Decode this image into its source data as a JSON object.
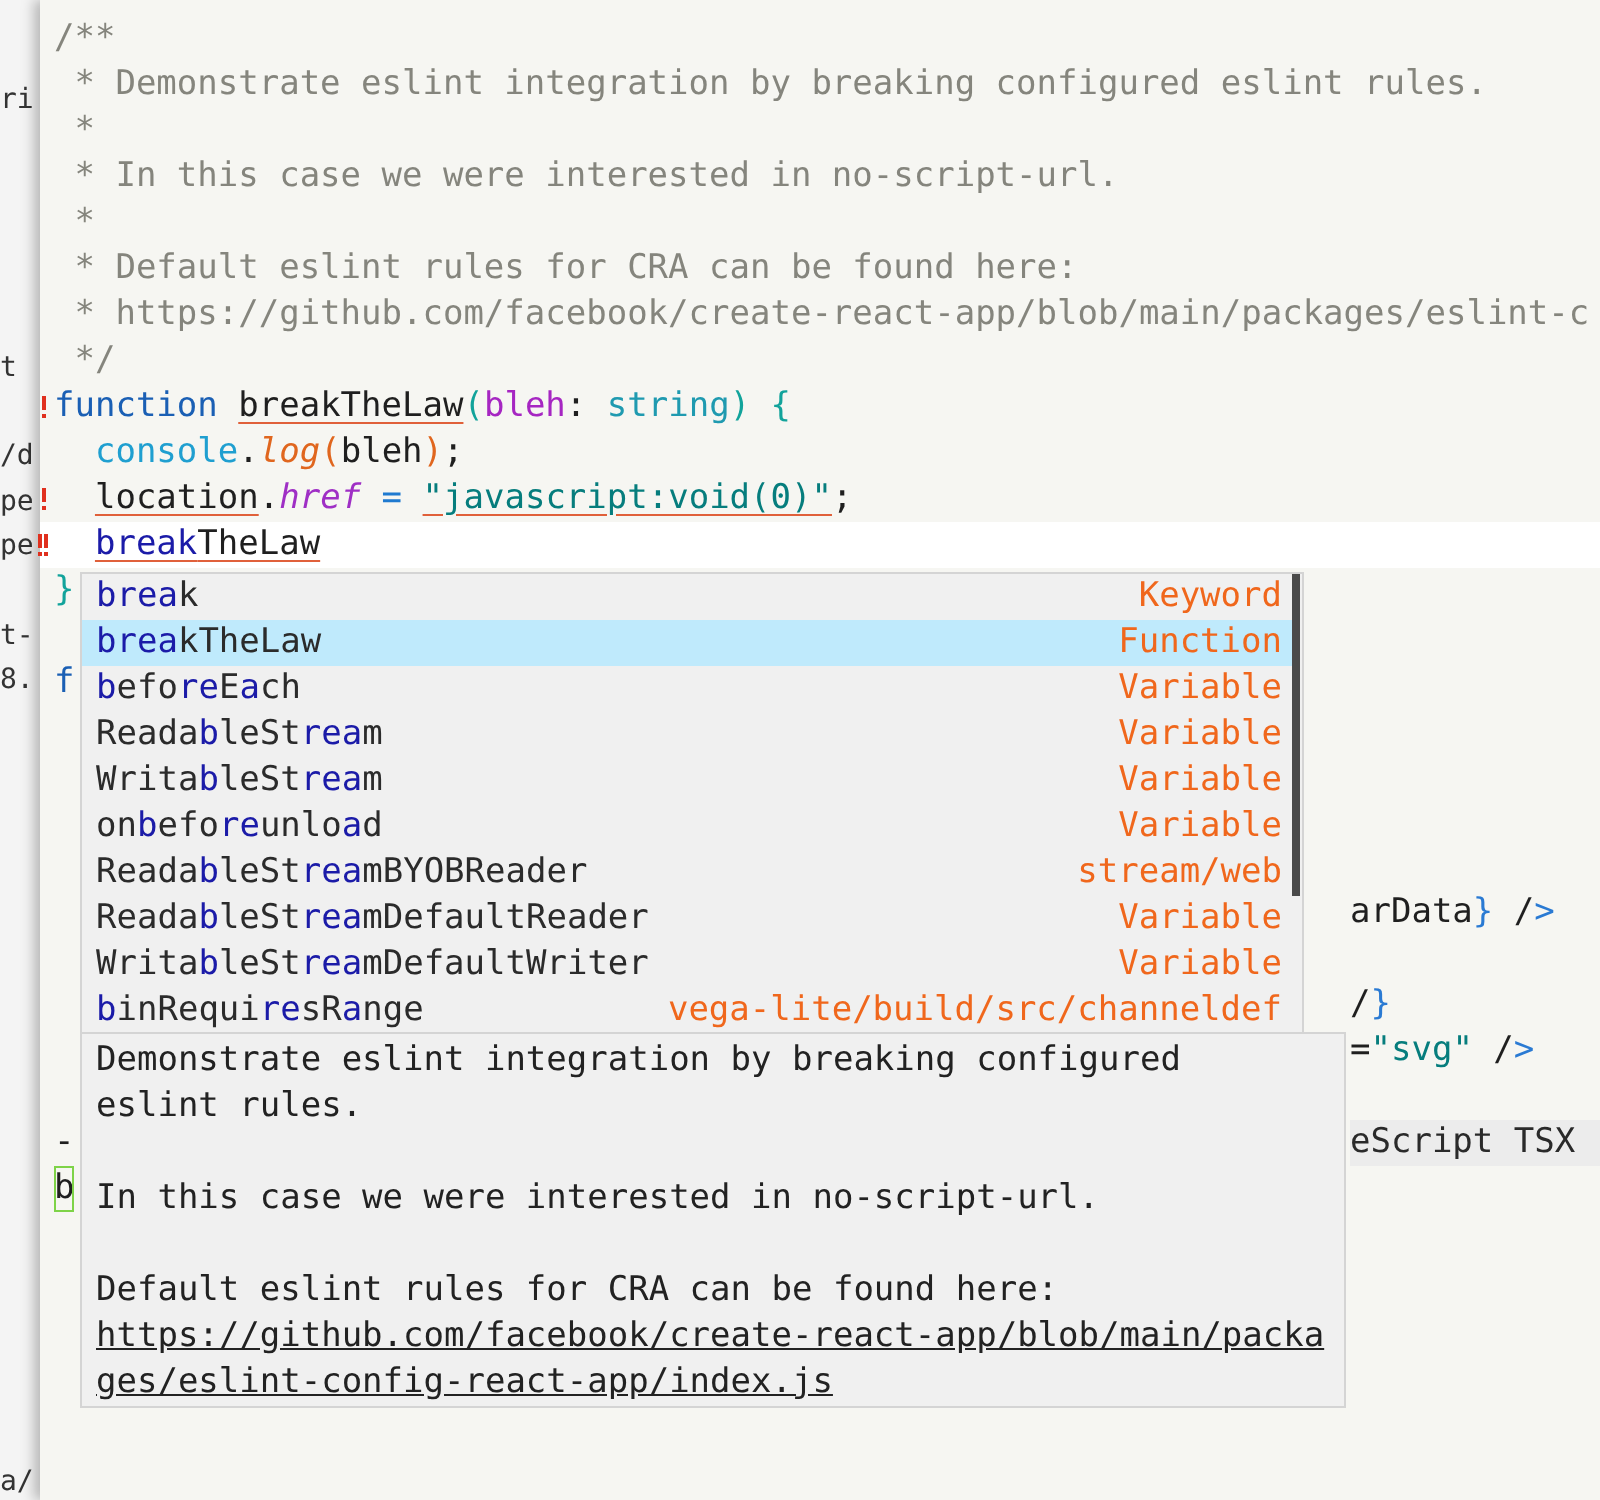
{
  "background_window": {
    "lines": [
      {
        "kind": "text",
        "text": "ri"
      },
      {
        "kind": "blank"
      },
      {
        "kind": "blank"
      },
      {
        "kind": "blank"
      },
      {
        "kind": "blank"
      },
      {
        "kind": "blank"
      },
      {
        "kind": "text",
        "text": "t"
      },
      {
        "kind": "blank"
      },
      {
        "kind": "text",
        "text": "/d"
      },
      {
        "kind": "text",
        "text": "pe"
      },
      {
        "kind": "text",
        "text": "pe"
      },
      {
        "kind": "blank"
      },
      {
        "kind": "text",
        "text": "t-"
      },
      {
        "kind": "text",
        "text": "8."
      },
      {
        "kind": "blank"
      },
      {
        "kind": "blank"
      },
      {
        "kind": "blank"
      },
      {
        "kind": "blank"
      },
      {
        "kind": "blank"
      },
      {
        "kind": "blank"
      },
      {
        "kind": "blank"
      },
      {
        "kind": "blank"
      },
      {
        "kind": "blank"
      },
      {
        "kind": "blank"
      },
      {
        "kind": "blank"
      },
      {
        "kind": "blank"
      },
      {
        "kind": "blank"
      },
      {
        "kind": "blank"
      },
      {
        "kind": "blank"
      },
      {
        "kind": "blank"
      },
      {
        "kind": "blank"
      },
      {
        "kind": "text",
        "text": "a/"
      }
    ]
  },
  "editor": {
    "lines": [
      {
        "kind": "code",
        "segments": [
          {
            "kind": "comment",
            "text": "/**"
          }
        ]
      },
      {
        "kind": "code",
        "segments": [
          {
            "kind": "comment",
            "text": " * Demonstrate eslint integration by breaking configured eslint rules."
          }
        ]
      },
      {
        "kind": "code",
        "segments": [
          {
            "kind": "comment",
            "text": " *"
          }
        ]
      },
      {
        "kind": "code",
        "segments": [
          {
            "kind": "comment",
            "text": " * In this case we were interested in no-script-url."
          }
        ]
      },
      {
        "kind": "code",
        "segments": [
          {
            "kind": "comment",
            "text": " *"
          }
        ]
      },
      {
        "kind": "code",
        "segments": [
          {
            "kind": "comment",
            "text": " * Default eslint rules for CRA can be found here:"
          }
        ]
      },
      {
        "kind": "code",
        "segments": [
          {
            "kind": "comment",
            "text": " * https://github.com/facebook/create-react-app/blob/main/packages/eslint-c"
          }
        ]
      },
      {
        "kind": "code",
        "segments": [
          {
            "kind": "comment",
            "text": " */"
          }
        ]
      },
      {
        "kind": "code",
        "error": true,
        "multiple_errors": false,
        "segments": [
          {
            "kind": "keyword",
            "text": "function "
          },
          {
            "kind": "plain",
            "text": "breakTheLaw",
            "underline": true
          },
          {
            "kind": "bracket",
            "text": "("
          },
          {
            "kind": "param",
            "text": "bleh"
          },
          {
            "kind": "plain",
            "text": ": "
          },
          {
            "kind": "type",
            "text": "string"
          },
          {
            "kind": "bracket",
            "text": ") {"
          }
        ]
      },
      {
        "kind": "indented_code",
        "segments": [
          {
            "kind": "global",
            "text": "console"
          },
          {
            "kind": "plain",
            "text": "."
          },
          {
            "kind": "method",
            "text": "log"
          },
          {
            "kind": "call",
            "text": "("
          },
          {
            "kind": "plain",
            "text": "bleh"
          },
          {
            "kind": "call",
            "text": ")"
          },
          {
            "kind": "plain",
            "text": ";"
          }
        ]
      },
      {
        "kind": "indented_code",
        "error": true,
        "multiple_errors": false,
        "segments": [
          {
            "kind": "plain",
            "text": "location",
            "underline": true
          },
          {
            "kind": "plain",
            "text": "."
          },
          {
            "kind": "property",
            "text": "href"
          },
          {
            "kind": "operator",
            "text": " = "
          },
          {
            "kind": "string",
            "text": "\"javascript:void(0)\"",
            "underline": true
          },
          {
            "kind": "plain",
            "text": ";"
          }
        ]
      },
      {
        "kind": "indented_code",
        "error": true,
        "multiple_errors": true,
        "current": true,
        "segments": [
          {
            "kind": "typed",
            "text": "break",
            "underline": true
          },
          {
            "kind": "plain",
            "text": "TheLaw",
            "underline": true
          }
        ]
      },
      {
        "kind": "code",
        "segments": [
          {
            "kind": "bracket",
            "text": "}"
          }
        ]
      },
      {
        "kind": "blank"
      },
      {
        "kind": "code",
        "segments": [
          {
            "kind": "keyword",
            "text": "f"
          }
        ]
      },
      {
        "kind": "blank"
      },
      {
        "kind": "blank"
      },
      {
        "kind": "blank"
      },
      {
        "kind": "blank"
      },
      {
        "kind": "code",
        "tail": [
          {
            "kind": "plain",
            "text": "arData"
          },
          {
            "kind": "brace",
            "text": "}"
          },
          {
            "kind": "plain",
            "text": " /"
          },
          {
            "kind": "brace",
            "text": ">"
          }
        ]
      },
      {
        "kind": "blank"
      },
      {
        "kind": "code",
        "tail": [
          {
            "kind": "plain",
            "text": "/"
          },
          {
            "kind": "brace",
            "text": "}"
          }
        ]
      },
      {
        "kind": "code",
        "tail": [
          {
            "kind": "plain",
            "text": "="
          },
          {
            "kind": "string",
            "text": "\"svg\""
          },
          {
            "kind": "plain",
            "text": " /"
          },
          {
            "kind": "brace",
            "text": ">"
          }
        ]
      },
      {
        "kind": "blank"
      },
      {
        "kind": "code",
        "segments": [
          {
            "kind": "plain",
            "text": "-"
          }
        ],
        "tail": [
          {
            "kind": "hint",
            "text": "eScript TSX"
          }
        ]
      },
      {
        "kind": "code",
        "segments": [
          {
            "kind": "boxed",
            "text": "b"
          }
        ]
      }
    ]
  },
  "completion": {
    "items": [
      {
        "name": "**brea**k",
        "type": "Keyword",
        "selected": false
      },
      {
        "name": "**brea**kTheLaw",
        "type": "Function",
        "selected": true
      },
      {
        "name": "**b**efo**re**E**a**ch",
        "type": "Variable",
        "selected": false
      },
      {
        "name": "Reada**b**leSt**rea**m",
        "type": "Variable",
        "selected": false
      },
      {
        "name": "Writa**b**leSt**rea**m",
        "type": "Variable",
        "selected": false
      },
      {
        "name": "on**b**efo**re**unlo**a**d",
        "type": "Variable",
        "selected": false
      },
      {
        "name": "Reada**b**leSt**rea**mBYOBReader",
        "type": "stream/web",
        "selected": false
      },
      {
        "name": "Reada**b**leSt**rea**mDefaultReader",
        "type": "Variable",
        "selected": false
      },
      {
        "name": "Writa**b**leSt**rea**mDefaultWriter",
        "type": "Variable",
        "selected": false
      },
      {
        "name": "**b**inRequi**re**sR**a**nge",
        "type": "vega-lite/build/src/channeldef",
        "selected": false
      }
    ]
  },
  "documentation": {
    "paragraphs": [
      {
        "text": "Demonstrate eslint integration by breaking configured eslint rules."
      },
      {
        "text": "In this case we were interested in no-script-url."
      },
      {
        "text": "Default eslint rules for CRA can be found here:",
        "link": "https://github.com/facebook/create-react-app/blob/main/packages/eslint-config-react-app/index.js"
      }
    ]
  }
}
